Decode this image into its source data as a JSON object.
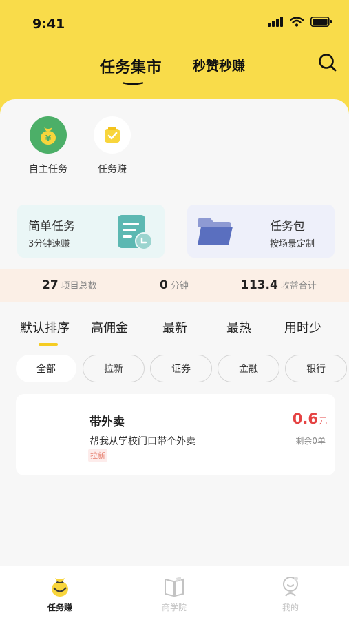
{
  "status_bar": {
    "time": "9:41"
  },
  "header": {
    "tabs": [
      {
        "label": "任务集市",
        "active": true
      },
      {
        "label": "秒赞秒赚",
        "active": false
      }
    ],
    "search_icon": "search-icon"
  },
  "quick_actions": [
    {
      "label": "自主任务",
      "icon": "money-bag-icon",
      "color": "#4caf68"
    },
    {
      "label": "任务赚",
      "icon": "check-note-icon",
      "color": "#f8d53c"
    }
  ],
  "promo_cards": [
    {
      "title": "简单任务",
      "subtitle": "3分钟速赚",
      "icon": "document-clock-icon",
      "color": "#5cb8b2"
    },
    {
      "title": "任务包",
      "subtitle": "按场景定制",
      "icon": "folder-icon",
      "color": "#5a6fbf"
    }
  ],
  "stats": [
    {
      "value": "27",
      "label": "项目总数"
    },
    {
      "value": "0",
      "label": "分钟"
    },
    {
      "value": "113.4",
      "label": "收益合计"
    }
  ],
  "sort_tabs": [
    {
      "label": "默认排序",
      "active": true
    },
    {
      "label": "高佣金",
      "active": false
    },
    {
      "label": "最新",
      "active": false
    },
    {
      "label": "最热",
      "active": false
    },
    {
      "label": "用时少",
      "active": false
    }
  ],
  "category_chips": [
    {
      "label": "全部",
      "active": true
    },
    {
      "label": "拉新",
      "active": false
    },
    {
      "label": "证券",
      "active": false
    },
    {
      "label": "金融",
      "active": false
    },
    {
      "label": "银行",
      "active": false
    }
  ],
  "tasks": [
    {
      "title": "带外卖",
      "description": "帮我从学校门口带个外卖",
      "tag": "拉新",
      "price": "0.6",
      "price_unit": "元",
      "remaining": "剩余0单"
    }
  ],
  "bottom_nav": [
    {
      "label": "任务赚",
      "icon": "money-bag-icon",
      "active": true
    },
    {
      "label": "商学院",
      "icon": "book-icon",
      "active": false
    },
    {
      "label": "我的",
      "icon": "profile-icon",
      "active": false
    }
  ],
  "colors": {
    "brand_yellow": "#f9dc4a",
    "accent_yellow": "#f5cc22",
    "price_red": "#e54343",
    "tag_red": "#e57d6c",
    "stats_bg": "#fbefe6"
  }
}
